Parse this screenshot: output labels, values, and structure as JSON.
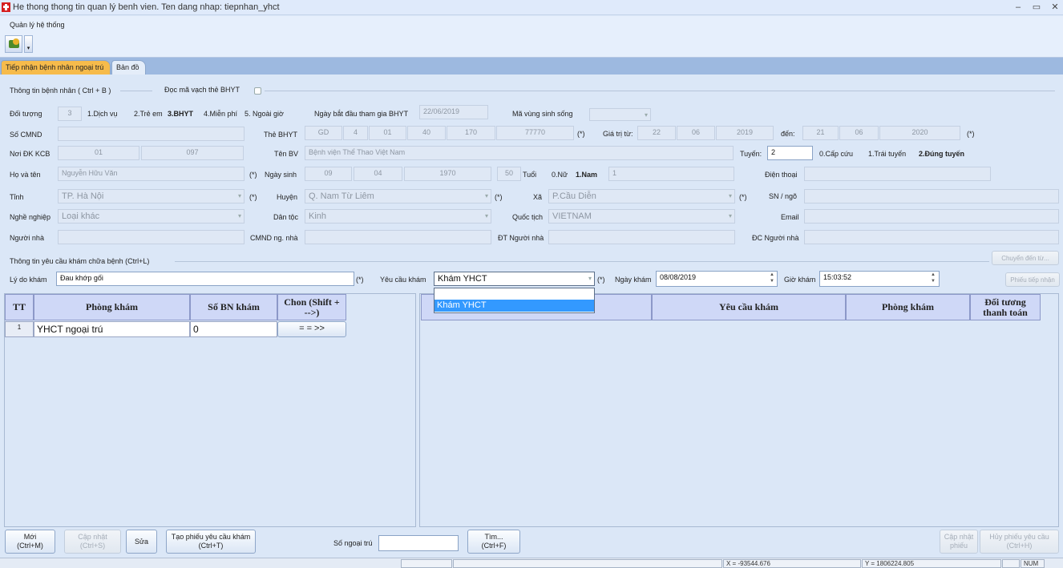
{
  "window": {
    "title": "He thong thong tin quan lý benh vien. Ten dang nhap: tiepnhan_yhct",
    "min": "–",
    "restore": "▭",
    "close": "✕"
  },
  "menu": {
    "system": "Quản lý hệ thống",
    "toolbar_dropdown": "▾"
  },
  "tabs": [
    {
      "label": "Tiếp nhận bệnh nhân ngoại trú"
    },
    {
      "label": "Bản đồ"
    }
  ],
  "patient": {
    "section_title": "Thông tin bệnh nhân ( Ctrl + B )",
    "barcode_label": "Đọc mã vạch thẻ BHYT",
    "doituong_label": "Đối tượng",
    "doituong_value": "3",
    "opt1": "1.Dịch vụ",
    "opt2": "2.Trẻ em",
    "opt3": "3.BHYT",
    "opt4": "4.Miễn phí",
    "opt5": "5. Ngoài giờ",
    "ngaybd_label": "Ngày bắt đầu tham gia BHYT",
    "ngaybd_value": "22/06/2019",
    "mavung_label": "Mã vùng sinh sống",
    "cmnd_label": "Số CMND",
    "thebhyt_label": "Thẻ BHYT",
    "thebhyt": [
      "GD",
      "4",
      "01",
      "40",
      "170",
      "77770"
    ],
    "giatri_label": "Giá trị từ:",
    "giatri_tu": [
      "22",
      "06",
      "2019"
    ],
    "den_label": "đến:",
    "giatri_den": [
      "21",
      "06",
      "2020"
    ],
    "noidk_label": "Nơi ĐK KCB",
    "noidk": [
      "01",
      "097"
    ],
    "tenbv_label": "Tên BV",
    "tenbv_value": "Bệnh viện Thể Thao Việt Nam",
    "tuyen_label": "Tuyến:",
    "tuyen_value": "2",
    "tuyen_opt0": "0.Cấp cứu",
    "tuyen_opt1": "1.Trái tuyến",
    "tuyen_opt2": "2.Đúng tuyến",
    "hoten_label": "Họ và tên",
    "hoten_value": "Nguyễn Hữu Văn",
    "ngaysinh_label": "Ngày sinh",
    "ngaysinh": [
      "09",
      "04",
      "1970"
    ],
    "tuoi_value": "50",
    "tuoi_label": "Tuổi",
    "gt_nu": "0.Nữ",
    "gt_nam": "1.Nam",
    "gt_value": "1",
    "dienthoai_label": "Điện thoại",
    "tinh_label": "Tỉnh",
    "tinh_value": "TP. Hà Nội",
    "huyen_label": "Huyện",
    "huyen_value": "Q. Nam Từ Liêm",
    "xa_label": "Xã",
    "xa_value": "P.Cầu Diễn",
    "sn_label": "SN / ngõ",
    "nghe_label": "Nghề nghiệp",
    "nghe_value": "Loại khác",
    "dantoc_label": "Dân tộc",
    "dantoc_value": "Kinh",
    "quoctich_label": "Quốc tịch",
    "quoctich_value": "VIETNAM",
    "email_label": "Email",
    "nguoinha_label": "Người nhà",
    "cmndnha_label": "CMND ng. nhà",
    "dtnha_label": "ĐT Người nhà",
    "dcnha_label": "ĐC Người nhà",
    "required": "(*)"
  },
  "request": {
    "section_title": "Thông tin yêu cầu khám chữa bệnh (Ctrl+L)",
    "chuyen_btn": "Chuyển đến từ...",
    "lydo_label": "Lý do khám",
    "lydo_value": "Đau khớp gối",
    "yeucau_label": "Yêu cầu khám",
    "yeucau_value": "Khám YHCT",
    "ngaykham_label": "Ngày khám",
    "ngaykham_value": "08/08/2019",
    "giokham_label": "Giờ khám",
    "giokham_value": "15:03:52",
    "phieu_btn": "Phiếu tiếp nhận",
    "dropdown_options": [
      "Khám YHCT"
    ]
  },
  "left_table": {
    "headers": [
      "TT",
      "Phòng khám",
      "Số BN khám",
      "Chon (Shift + -->)"
    ],
    "rows": [
      {
        "tt": "1",
        "phong": "YHCT ngoại trú",
        "so": "0",
        "chon": "= = >>"
      }
    ]
  },
  "right_table": {
    "headers": [
      "Yêu cầu khám",
      "Phòng khám",
      "Đối tương thanh toán"
    ]
  },
  "bottom": {
    "moi": "Mới\n(Ctrl+M)",
    "capnhat": "Cập nhật\n(Ctrl+S)",
    "sua": "Sửa",
    "taophieu": "Tạo phiếu yêu cầu khám\n(Ctrl+T)",
    "songoaitru_label": "Số ngoại trú",
    "tim": "Tìm...\n(Ctrl+F)",
    "capnhatphieu": "Cập nhật\nphiếu",
    "huyphieu": "Hủy phiếu yêu cầu\n(Ctrl+H)"
  },
  "status": {
    "x": "X = -93544.676",
    "y": "Y = 1806224.805",
    "num": "NUM"
  }
}
